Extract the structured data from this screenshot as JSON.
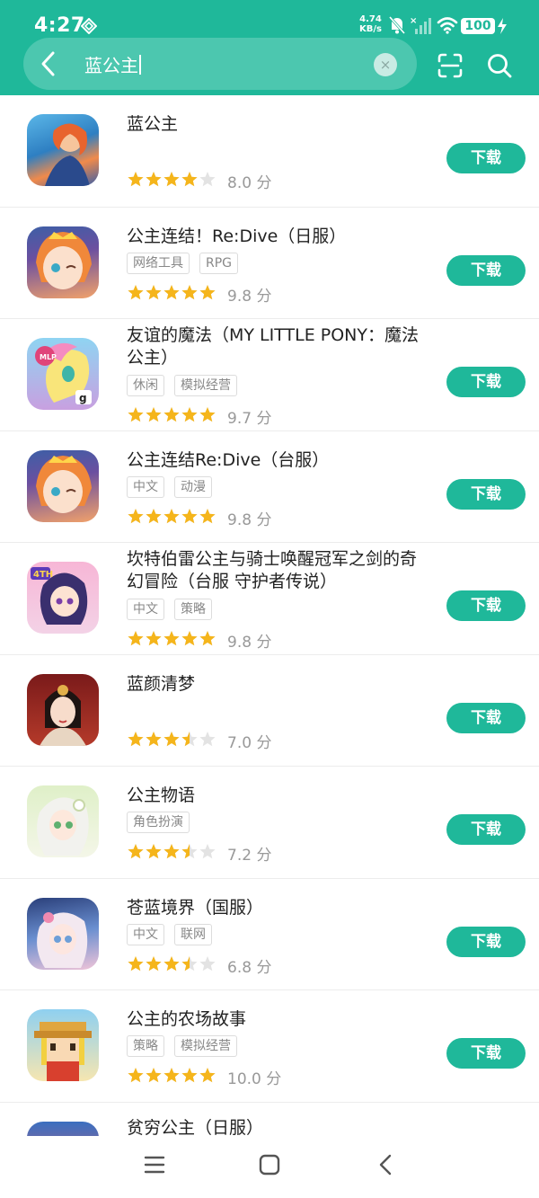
{
  "status_bar": {
    "time": "4:27",
    "net_speed_value": "4.74",
    "net_speed_unit": "KB/s",
    "battery": "100",
    "icons": [
      "vpn-diamond-icon",
      "mute-bell-icon",
      "no-signal-icon",
      "wifi-icon",
      "battery-icon",
      "charging-bolt-icon"
    ]
  },
  "search": {
    "query": "蓝公主",
    "clear_icon": "×",
    "back_icon": "back-chevron-icon",
    "scan_icon": "scan-icon",
    "search_icon": "search-icon"
  },
  "colors": {
    "accent": "#1fb89a",
    "star": "#f5b51b",
    "star_empty": "#e3e3e3"
  },
  "download_label": "下载",
  "results": [
    {
      "name": "蓝公主",
      "tags": [],
      "stars": 4,
      "score": "8.0 分"
    },
    {
      "name": "公主连结！Re:Dive（日服）",
      "tags": [
        "网络工具",
        "RPG"
      ],
      "stars": 5,
      "score": "9.8 分"
    },
    {
      "name": "友谊的魔法（MY LITTLE PONY：魔法公主）",
      "tags": [
        "休闲",
        "模拟经营"
      ],
      "stars": 5,
      "score": "9.7 分"
    },
    {
      "name": "公主连结Re:Dive（台服）",
      "tags": [
        "中文",
        "动漫"
      ],
      "stars": 5,
      "score": "9.8 分"
    },
    {
      "name": "坎特伯雷公主与骑士唤醒冠军之剑的奇幻冒险（台服 守护者传说）",
      "tags": [
        "中文",
        "策略"
      ],
      "stars": 5,
      "score": "9.8 分"
    },
    {
      "name": "蓝颜清梦",
      "tags": [],
      "stars": 3.5,
      "score": "7.0 分"
    },
    {
      "name": "公主物语",
      "tags": [
        "角色扮演"
      ],
      "stars": 3.5,
      "score": "7.2 分"
    },
    {
      "name": "苍蓝境界（国服）",
      "tags": [
        "中文",
        "联网"
      ],
      "stars": 3.5,
      "score": "6.8 分"
    },
    {
      "name": "公主的农场故事",
      "tags": [
        "策略",
        "模拟经营"
      ],
      "stars": 5,
      "score": "10.0 分"
    },
    {
      "name": "贫穷公主（日服）",
      "tags": [],
      "stars": null,
      "score": null
    }
  ],
  "navbar": {
    "icons": [
      "menu-icon",
      "home-icon",
      "back-icon"
    ]
  }
}
